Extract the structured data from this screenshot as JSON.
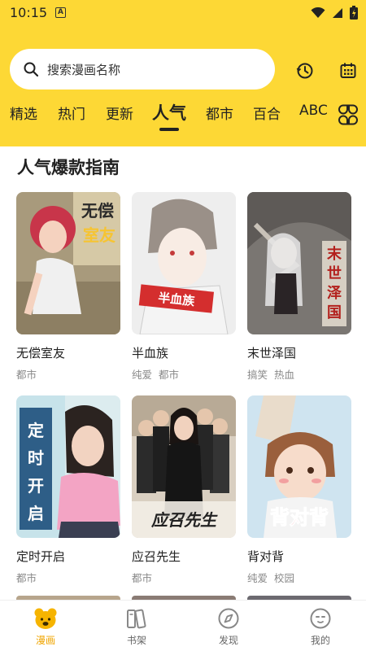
{
  "status_bar": {
    "time": "10:15",
    "notification_letter": "A"
  },
  "search": {
    "placeholder": "搜索漫画名称"
  },
  "tabs": [
    {
      "label": "精选"
    },
    {
      "label": "热门"
    },
    {
      "label": "更新"
    },
    {
      "label": "人气",
      "active": true
    },
    {
      "label": "都市"
    },
    {
      "label": "百合"
    },
    {
      "label": "ABC"
    }
  ],
  "section": {
    "title": "人气爆款指南"
  },
  "comics": [
    {
      "title": "无偿室友",
      "tags": [
        "都市"
      ],
      "cover_text": "无偿室友"
    },
    {
      "title": "半血族",
      "tags": [
        "纯爱",
        "都市"
      ],
      "cover_text": "半血族"
    },
    {
      "title": "末世泽国",
      "tags": [
        "搞笑",
        "热血"
      ],
      "cover_text": "末世泽国"
    },
    {
      "title": "定时开启",
      "tags": [
        "都市"
      ],
      "cover_text": "定时开启"
    },
    {
      "title": "应召先生",
      "tags": [
        "都市"
      ],
      "cover_text": "应召先生"
    },
    {
      "title": "背对背",
      "tags": [
        "纯爱",
        "校园"
      ],
      "cover_text": "背对背"
    }
  ],
  "bottom_nav": [
    {
      "label": "漫画",
      "icon": "bear-icon",
      "active": true
    },
    {
      "label": "书架",
      "icon": "bookshelf-icon"
    },
    {
      "label": "发现",
      "icon": "compass-icon"
    },
    {
      "label": "我的",
      "icon": "face-icon"
    }
  ],
  "colors": {
    "header": "#fdd835",
    "accent": "#f0a500",
    "tag_text": "#888888"
  }
}
